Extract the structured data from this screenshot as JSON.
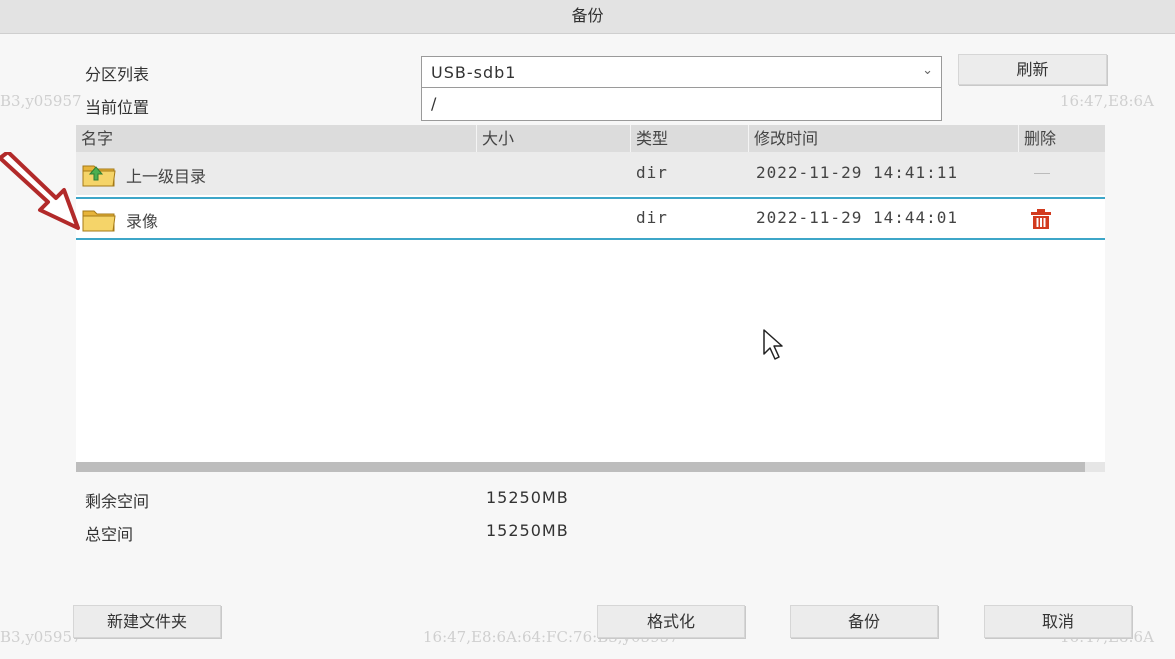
{
  "window": {
    "title": "备份"
  },
  "watermark": {
    "left": "B3,y05957",
    "center": "16:47,E8:6A:64:FC:76:B3,y05957",
    "right": "16:47,E8:6A"
  },
  "form": {
    "partition_label": "分区列表",
    "partition_value": "USB-sdb1",
    "location_label": "当前位置",
    "location_value": "/",
    "refresh_label": "刷新"
  },
  "table": {
    "columns": [
      "名字",
      "大小",
      "类型",
      "修改时间",
      "删除"
    ],
    "rows": [
      {
        "name": "上一级目录",
        "size": "",
        "type": "dir",
        "modified": "2022-11-29 14:41:11",
        "icon": "parent-folder-icon",
        "delete": "none"
      },
      {
        "name": "录像",
        "size": "",
        "type": "dir",
        "modified": "2022-11-29 14:44:01",
        "icon": "folder-icon",
        "delete": "trash-icon"
      }
    ]
  },
  "space": {
    "free_label": "剩余空间",
    "free_value": "15250MB",
    "total_label": "总空间",
    "total_value": "15250MB"
  },
  "buttons": {
    "new_folder": "新建文件夹",
    "format": "格式化",
    "backup": "备份",
    "cancel": "取消"
  },
  "colors": {
    "selection_border": "#3da6c8",
    "trash": "#d23a1e",
    "folder": "#f3c548",
    "annotation_arrow": "#b22a2a"
  }
}
